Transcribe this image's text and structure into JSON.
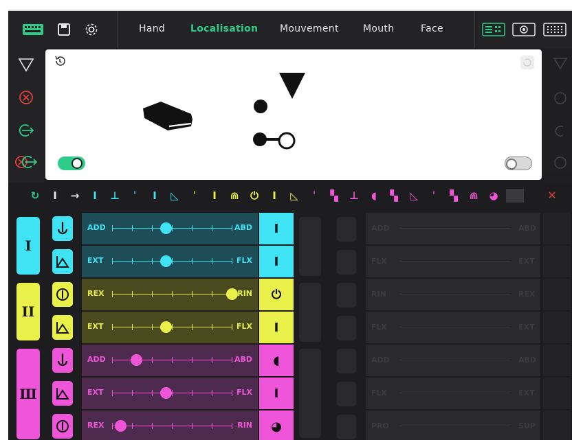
{
  "nav": {
    "items": [
      "Hand",
      "Localisation",
      "Mouvement",
      "Mouth",
      "Face"
    ],
    "active": "Localisation"
  },
  "colors": {
    "accent": "#2ecc8a",
    "cyan": "#3fe3f4",
    "yellow": "#eaf04a",
    "magenta": "#ef55d8",
    "panel_cyan": "#1f4d57",
    "panel_yellow": "#4a4a1f",
    "panel_magenta": "#4e2b4e",
    "close": "#e0403a"
  },
  "groups": [
    {
      "symbol": "I",
      "color": "cyan",
      "rows": [
        {
          "left": "ADD",
          "right": "ABD",
          "value": 0.45,
          "indicator": "I"
        },
        {
          "left": "EXT",
          "right": "FLX",
          "value": 0.45,
          "indicator": "I"
        }
      ]
    },
    {
      "symbol": "II",
      "color": "yellow",
      "rows": [
        {
          "left": "REX",
          "right": "RIN",
          "value": 1.0,
          "indicator": "⏻"
        },
        {
          "left": "EXT",
          "right": "FLX",
          "value": 0.45,
          "indicator": "I"
        }
      ]
    },
    {
      "symbol": "Ш",
      "color": "magenta",
      "rows": [
        {
          "left": "ADD",
          "right": "ABD",
          "value": 0.2,
          "indicator": "◖"
        },
        {
          "left": "EXT",
          "right": "FLX",
          "value": 0.45,
          "indicator": "I"
        },
        {
          "left": "REX",
          "right": "RIN",
          "value": 0.07,
          "indicator": "◕"
        }
      ]
    }
  ],
  "ghost_labels": [
    {
      "left": "ADD",
      "right": "ABD"
    },
    {
      "left": "FLX",
      "right": "EXT"
    },
    {
      "left": "RIN",
      "right": "REX"
    },
    {
      "left": "FLX",
      "right": "EXT"
    },
    {
      "left": "ADD",
      "right": "ABD"
    },
    {
      "left": "FLX",
      "right": "EXT"
    },
    {
      "left": "PRO",
      "right": "SUP"
    }
  ],
  "toggles": {
    "left_on": true,
    "right_on": false
  }
}
